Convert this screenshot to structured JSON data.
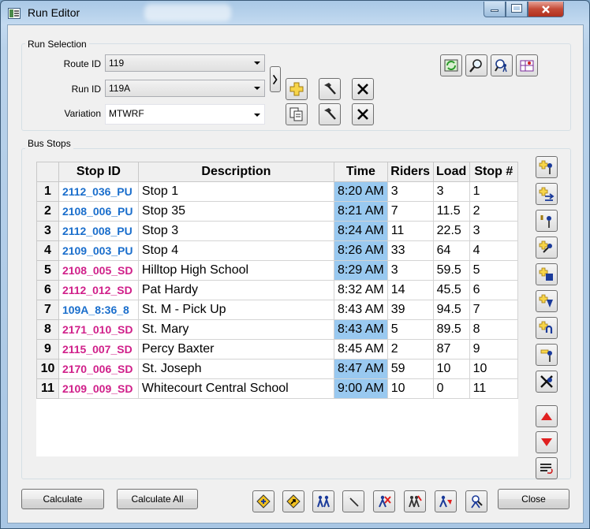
{
  "window": {
    "title": "Run Editor"
  },
  "run_selection": {
    "legend": "Run Selection",
    "route_label": "Route ID",
    "route_value": "119",
    "run_label": "Run ID",
    "run_value": "119A",
    "variation_label": "Variation",
    "variation_value": "MTWRF"
  },
  "bus_stops": {
    "legend": "Bus Stops",
    "columns": [
      "Stop ID",
      "Description",
      "Time",
      "Riders",
      "Load",
      "Stop #"
    ],
    "rows": [
      {
        "num": "1",
        "stop_id": "2112_036_PU",
        "kind": "pu",
        "desc": "Stop 1",
        "time": "8:20 AM",
        "hl": true,
        "riders": "3",
        "load": "3",
        "stop": "1"
      },
      {
        "num": "2",
        "stop_id": "2108_006_PU",
        "kind": "pu",
        "desc": "Stop 35",
        "time": "8:21 AM",
        "hl": true,
        "riders": "7",
        "load": "11.5",
        "stop": "2"
      },
      {
        "num": "3",
        "stop_id": "2112_008_PU",
        "kind": "pu",
        "desc": "Stop 3",
        "time": "8:24 AM",
        "hl": true,
        "riders": "11",
        "load": "22.5",
        "stop": "3"
      },
      {
        "num": "4",
        "stop_id": "2109_003_PU",
        "kind": "pu",
        "desc": "Stop 4",
        "time": "8:26 AM",
        "hl": true,
        "riders": "33",
        "load": "64",
        "stop": "4"
      },
      {
        "num": "5",
        "stop_id": "2108_005_SD",
        "kind": "sd",
        "desc": "Hilltop High School",
        "time": "8:29 AM",
        "hl": true,
        "riders": "3",
        "load": "59.5",
        "stop": "5"
      },
      {
        "num": "6",
        "stop_id": "2112_012_SD",
        "kind": "sd",
        "desc": "Pat Hardy",
        "time": "8:32 AM",
        "hl": false,
        "riders": "14",
        "load": "45.5",
        "stop": "6"
      },
      {
        "num": "7",
        "stop_id": "109A_8:36_8",
        "kind": "pu",
        "desc": "St. M - Pick Up",
        "time": "8:43 AM",
        "hl": false,
        "riders": "39",
        "load": "94.5",
        "stop": "7"
      },
      {
        "num": "8",
        "stop_id": "2171_010_SD",
        "kind": "sd",
        "desc": "St. Mary",
        "time": "8:43 AM",
        "hl": true,
        "riders": "5",
        "load": "89.5",
        "stop": "8"
      },
      {
        "num": "9",
        "stop_id": "2115_007_SD",
        "kind": "sd",
        "desc": "Percy Baxter",
        "time": "8:45 AM",
        "hl": false,
        "riders": "2",
        "load": "87",
        "stop": "9"
      },
      {
        "num": "10",
        "stop_id": "2170_006_SD",
        "kind": "sd",
        "desc": "St. Joseph",
        "time": "8:47 AM",
        "hl": true,
        "riders": "59",
        "load": "10",
        "stop": "10"
      },
      {
        "num": "11",
        "stop_id": "2109_009_SD",
        "kind": "sd",
        "desc": "Whitecourt Central School",
        "time": "9:00 AM",
        "hl": true,
        "riders": "10",
        "load": "0",
        "stop": "11"
      }
    ]
  },
  "footer": {
    "calculate_label": "Calculate",
    "calculate_all_label": "Calculate All",
    "close_label": "Close"
  },
  "colors": {
    "pickup_id": "#1a6ecc",
    "dropoff_id": "#d0208a",
    "time_highlight": "#99c9f0",
    "close_button": "#c44a36"
  },
  "icons": {
    "top_right": [
      "refresh-map-icon",
      "find-icon",
      "find-student-icon",
      "grid-map-icon"
    ],
    "side": [
      "add-stop-icon",
      "swap-stop-icon",
      "insert-stop-icon",
      "move-stop-icon",
      "stop-zone-icon",
      "stop-down-icon",
      "undo-stop-icon",
      "stop-edit-icon",
      "remove-stop-icon",
      "move-up-icon",
      "move-down-icon",
      "reorder-icon"
    ],
    "footer": [
      "route-settings-icon",
      "directions-icon",
      "students-icon",
      "wand-icon",
      "remove-students-icon",
      "assign-students-icon",
      "bus-students-icon",
      "inspect-icon"
    ]
  }
}
